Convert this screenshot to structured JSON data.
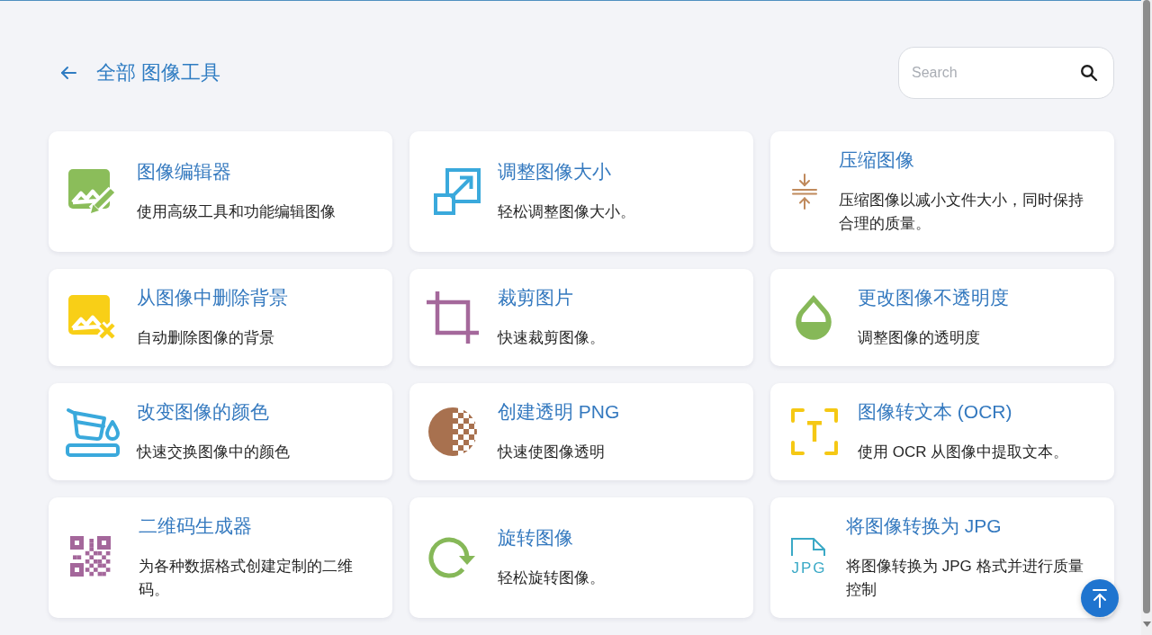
{
  "header": {
    "title": "全部 图像工具"
  },
  "search": {
    "placeholder": "Search"
  },
  "tools": [
    {
      "kind": "editor",
      "title": "图像编辑器",
      "description": "使用高级工具和功能编辑图像"
    },
    {
      "kind": "resize",
      "title": "调整图像大小",
      "description": "轻松调整图像大小。"
    },
    {
      "kind": "compress",
      "title": "压缩图像",
      "description": "压缩图像以减小文件大小，同时保持合理的质量。"
    },
    {
      "kind": "remove_bg",
      "title": "从图像中删除背景",
      "description": "自动删除图像的背景"
    },
    {
      "kind": "crop",
      "title": "裁剪图片",
      "description": "快速裁剪图像。"
    },
    {
      "kind": "opacity",
      "title": "更改图像不透明度",
      "description": "调整图像的透明度"
    },
    {
      "kind": "recolor",
      "title": "改变图像的颜色",
      "description": "快速交换图像中的颜色"
    },
    {
      "kind": "transparent",
      "title": "创建透明 PNG",
      "description": "快速使图像透明"
    },
    {
      "kind": "ocr",
      "title": "图像转文本 (OCR)",
      "description": "使用 OCR 从图像中提取文本。"
    },
    {
      "kind": "qr",
      "title": "二维码生成器",
      "description": "为各种数据格式创建定制的二维码。"
    },
    {
      "kind": "rotate",
      "title": "旋转图像",
      "description": "轻松旋转图像。"
    },
    {
      "kind": "jpg",
      "title": "将图像转换为 JPG",
      "description": "将图像转换为 JPG 格式并进行质量控制",
      "icon_text": "JPG"
    }
  ]
}
